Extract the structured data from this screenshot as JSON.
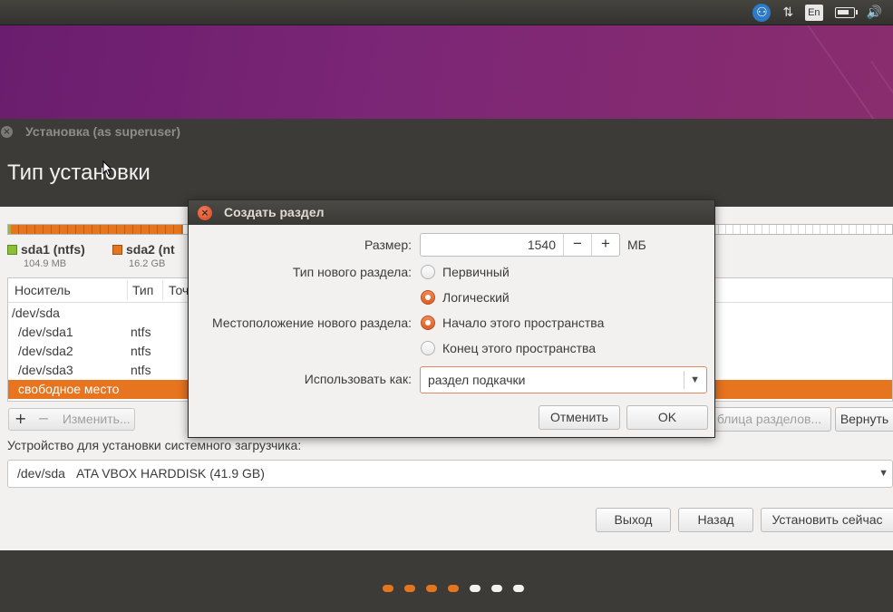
{
  "top_panel": {
    "tray_icons": [
      "accessibility-icon",
      "network-arrows-icon",
      "keyboard-layout-indicator",
      "battery-icon",
      "volume-icon"
    ],
    "lang": "En",
    "battery_level": 0.85
  },
  "installer": {
    "window_title": "Установка (as superuser)",
    "page_title": "Тип установки",
    "partitions_legend": [
      {
        "name": "sda1 (ntfs)",
        "size": "104.9 MB",
        "color": "#8ac036"
      },
      {
        "name": "sda2 (nt",
        "size": "16.2 GB",
        "color": "#e6751f"
      }
    ],
    "table": {
      "headers": [
        "Носитель",
        "Тип",
        "Точ"
      ],
      "rows": [
        {
          "device": "/dev/sda",
          "type": ""
        },
        {
          "device": "/dev/sda1",
          "type": "ntfs"
        },
        {
          "device": "/dev/sda2",
          "type": "ntfs"
        },
        {
          "device": "/dev/sda3",
          "type": "ntfs"
        },
        {
          "device": "свободное место",
          "type": ""
        }
      ]
    },
    "toolbar": {
      "add": "+",
      "remove": "−",
      "change": "Изменить..."
    },
    "new_table_button": "блица разделов...",
    "revert_button": "Вернуть",
    "bootloader": {
      "label": "Устройство для установки системного загрузчика:",
      "device": "/dev/sda",
      "description": "ATA VBOX HARDDISK (41.9 GB)"
    },
    "buttons": {
      "quit": "Выход",
      "back": "Назад",
      "install": "Установить сейчас"
    },
    "progress_dots": [
      {
        "state": "done",
        "color": "#e6751f"
      },
      {
        "state": "done",
        "color": "#e6751f"
      },
      {
        "state": "done",
        "color": "#e6751f"
      },
      {
        "state": "done",
        "color": "#e6751f"
      },
      {
        "state": "todo",
        "color": "#f2f1f0"
      },
      {
        "state": "todo",
        "color": "#f2f1f0"
      },
      {
        "state": "todo",
        "color": "#f2f1f0"
      }
    ]
  },
  "dialog": {
    "title": "Создать раздел",
    "size_label": "Размер:",
    "size_value": "1540",
    "size_unit": "МБ",
    "minus": "−",
    "plus": "+",
    "type_label": "Тип нового раздела:",
    "type_options": [
      {
        "label": "Первичный",
        "selected": false
      },
      {
        "label": "Логический",
        "selected": true
      }
    ],
    "location_label": "Местоположение нового раздела:",
    "location_options": [
      {
        "label": "Начало этого пространства",
        "selected": true
      },
      {
        "label": "Конец этого пространства",
        "selected": false
      }
    ],
    "use_as_label": "Использовать как:",
    "use_as_value": "раздел подкачки",
    "cancel": "Отменить",
    "ok": "OK"
  },
  "colors": {
    "accent": "#e6751f",
    "header": "#3c3b37",
    "desktop": "#7c2676"
  }
}
